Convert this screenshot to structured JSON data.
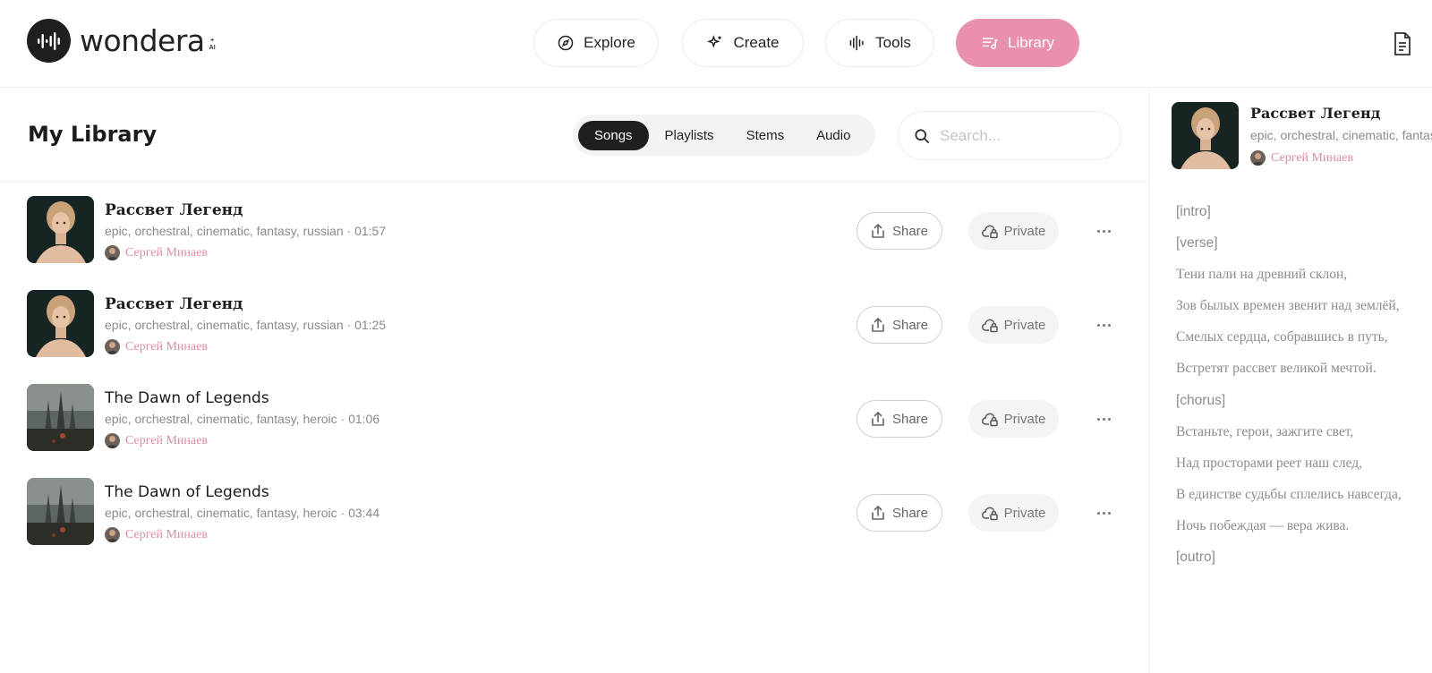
{
  "brand": {
    "name": "wondera",
    "sup": "+",
    "sub": "AI"
  },
  "nav": [
    {
      "label": "Explore",
      "icon": "compass-icon",
      "active": false
    },
    {
      "label": "Create",
      "icon": "sparkle-icon",
      "active": false
    },
    {
      "label": "Tools",
      "icon": "waveform-icon",
      "active": false
    },
    {
      "label": "Library",
      "icon": "library-icon",
      "active": true
    }
  ],
  "header_right_icon": "document-icon",
  "colors": {
    "accent": "#e890ad",
    "author": "#e08aa8",
    "dark": "#1f1f22"
  },
  "library": {
    "title": "My Library",
    "tabs": [
      {
        "label": "Songs",
        "active": true
      },
      {
        "label": "Playlists",
        "active": false
      },
      {
        "label": "Stems",
        "active": false
      },
      {
        "label": "Audio",
        "active": false
      }
    ],
    "search_placeholder": "Search...",
    "share_label": "Share",
    "private_label": "Private",
    "songs": [
      {
        "title": "Рассвет Легенд",
        "meta": "epic, orchestral, cinematic, fantasy, russian · 01:57",
        "author": "Сергей Минаев",
        "cover": "portrait"
      },
      {
        "title": "Рассвет Легенд",
        "meta": "epic, orchestral, cinematic, fantasy, russian · 01:25",
        "author": "Сергей Минаев",
        "cover": "portrait"
      },
      {
        "title": "The Dawn of Legends",
        "meta": "epic, orchestral, cinematic, fantasy, heroic · 01:06",
        "author": "Сергей Минаев",
        "cover": "castle"
      },
      {
        "title": "The Dawn of Legends",
        "meta": "epic, orchestral, cinematic, fantasy, heroic · 03:44",
        "author": "Сергей Минаев",
        "cover": "castle"
      }
    ]
  },
  "detail": {
    "title": "Рассвет Легенд",
    "meta": "epic, orchestral, cinematic, fantasy",
    "author": "Сергей Минаев",
    "lyrics": [
      "[intro]",
      "[verse]",
      "Тени пали на древний склон,",
      "Зов былых времен звенит над землёй,",
      "Смелых сердца, собравшись в путь,",
      "Встретят рассвет великой мечтой.",
      "[chorus]",
      "Встаньте, герои, зажгите свет,",
      "Над просторами реет наш след,",
      "В единстве судьбы сплелись навсегда,",
      "Ночь побеждая — вера жива.",
      "[outro]"
    ]
  }
}
